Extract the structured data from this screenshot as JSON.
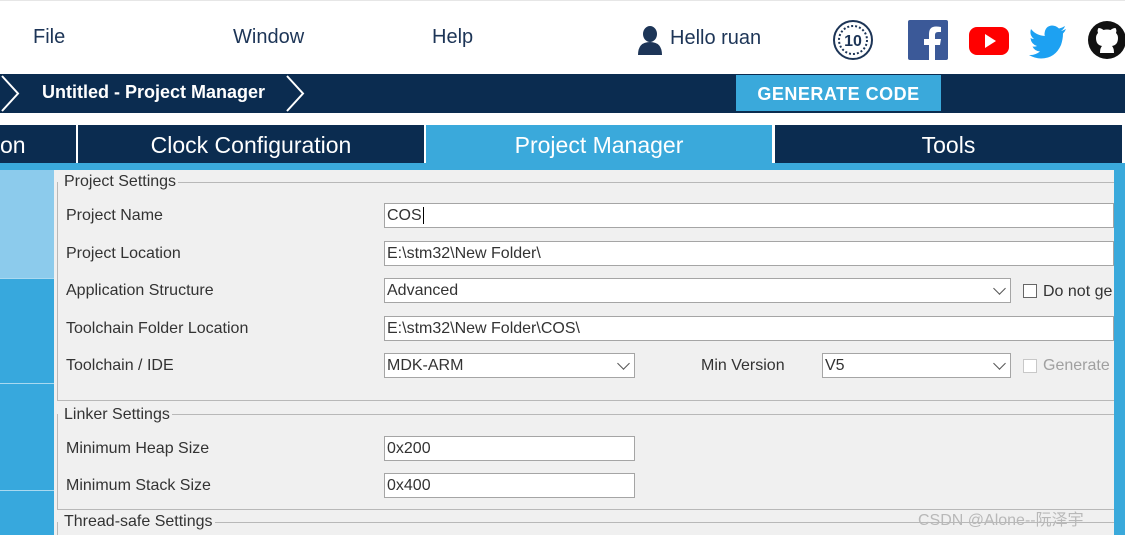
{
  "menu": {
    "file": "File",
    "window": "Window",
    "help": "Help",
    "greeting": "Hello ruan"
  },
  "social_icons": [
    "anniversary-10-badge-icon",
    "facebook-icon",
    "youtube-icon",
    "twitter-icon",
    "github-icon"
  ],
  "breadcrumb": {
    "title": "Untitled - Project Manager",
    "generate_label": "GENERATE CODE"
  },
  "tabs": [
    {
      "label": "on"
    },
    {
      "label": "Clock Configuration"
    },
    {
      "label": "Project Manager",
      "active": true
    },
    {
      "label": "Tools"
    }
  ],
  "project_settings": {
    "group_title": "Project Settings",
    "name_label": "Project Name",
    "name_value": "COS",
    "location_label": "Project Location",
    "location_value": "E:\\stm32\\New Folder\\",
    "app_structure_label": "Application Structure",
    "app_structure_value": "Advanced",
    "do_not_generate_label": "Do not ge",
    "toolchain_folder_label": "Toolchain Folder Location",
    "toolchain_folder_value": "E:\\stm32\\New Folder\\COS\\",
    "toolchain_ide_label": "Toolchain / IDE",
    "toolchain_ide_value": "MDK-ARM",
    "min_version_label": "Min Version",
    "min_version_value": "V5",
    "generate_label": "Generate"
  },
  "linker_settings": {
    "group_title": "Linker Settings",
    "heap_label": "Minimum Heap Size",
    "heap_value": "0x200",
    "stack_label": "Minimum Stack Size",
    "stack_value": "0x400"
  },
  "thread_safe": {
    "group_title": "Thread-safe Settings"
  },
  "watermark": "CSDN @Alone--阮泽宇",
  "colors": {
    "navy": "#0b2c50",
    "accent": "#3aa9db",
    "panel": "#f0f0f0"
  }
}
